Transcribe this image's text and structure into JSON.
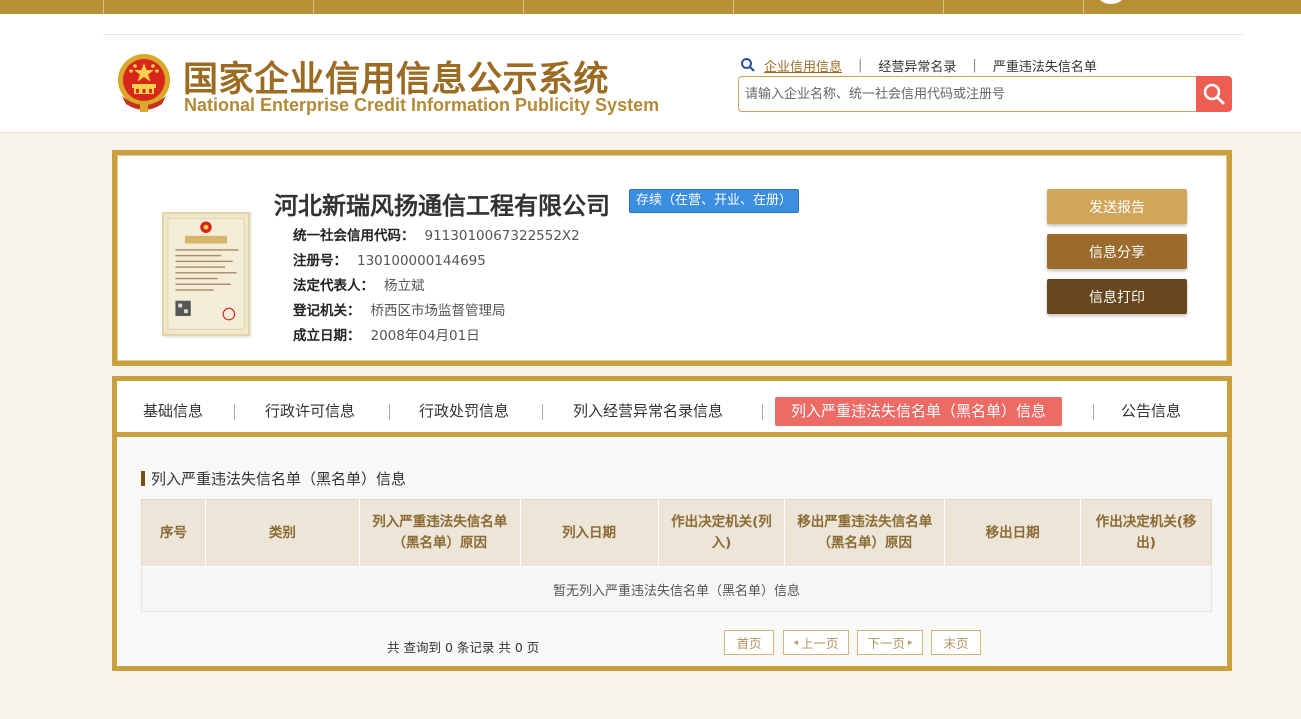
{
  "header": {
    "title_cn": "国家企业信用信息公示系统",
    "title_en": "National Enterprise Credit Information Publicity System",
    "search_tabs": [
      "企业信用信息",
      "经营异常名录",
      "严重违法失信名单"
    ],
    "search_placeholder": "请输入企业名称、统一社会信用代码或注册号"
  },
  "company": {
    "name": "河北新瑞风扬通信工程有限公司",
    "status": "存续（在营、开业、在册）",
    "fields": [
      {
        "label": "统一社会信用代码：",
        "value": "9113010067322552X2"
      },
      {
        "label": "注册号：",
        "value": "130100000144695"
      },
      {
        "label": "法定代表人：",
        "value": "杨立斌"
      },
      {
        "label": "登记机关：",
        "value": "桥西区市场监督管理局"
      },
      {
        "label": "成立日期：",
        "value": "2008年04月01日"
      }
    ],
    "actions": [
      "发送报告",
      "信息分享",
      "信息打印"
    ]
  },
  "tabs": [
    "基础信息",
    "行政许可信息",
    "行政处罚信息",
    "列入经营异常名录信息",
    "列入严重违法失信名单（黑名单）信息",
    "公告信息"
  ],
  "active_tab": "列入严重违法失信名单（黑名单）信息",
  "section": {
    "title": "列入严重违法失信名单（黑名单）信息",
    "columns": [
      "序号",
      "类别",
      "列入严重违法失信名单（黑名单）原因",
      "列入日期",
      "作出决定机关(列入)",
      "移出严重违法失信名单（黑名单）原因",
      "移出日期",
      "作出决定机关(移出)"
    ],
    "empty_text": "暂无列入严重违法失信名单（黑名单）信息"
  },
  "pager": {
    "summary": "共 查询到 0 条记录 共 0 页",
    "first": "首页",
    "prev": "上一页",
    "next": "下一页",
    "last": "末页"
  },
  "colors": {
    "gold": "#c9a03d",
    "title_brown": "#9c6b22",
    "badge_blue": "#3b8ee0",
    "active_tab_red": "#ee6a64",
    "search_red": "#ee5d52"
  }
}
